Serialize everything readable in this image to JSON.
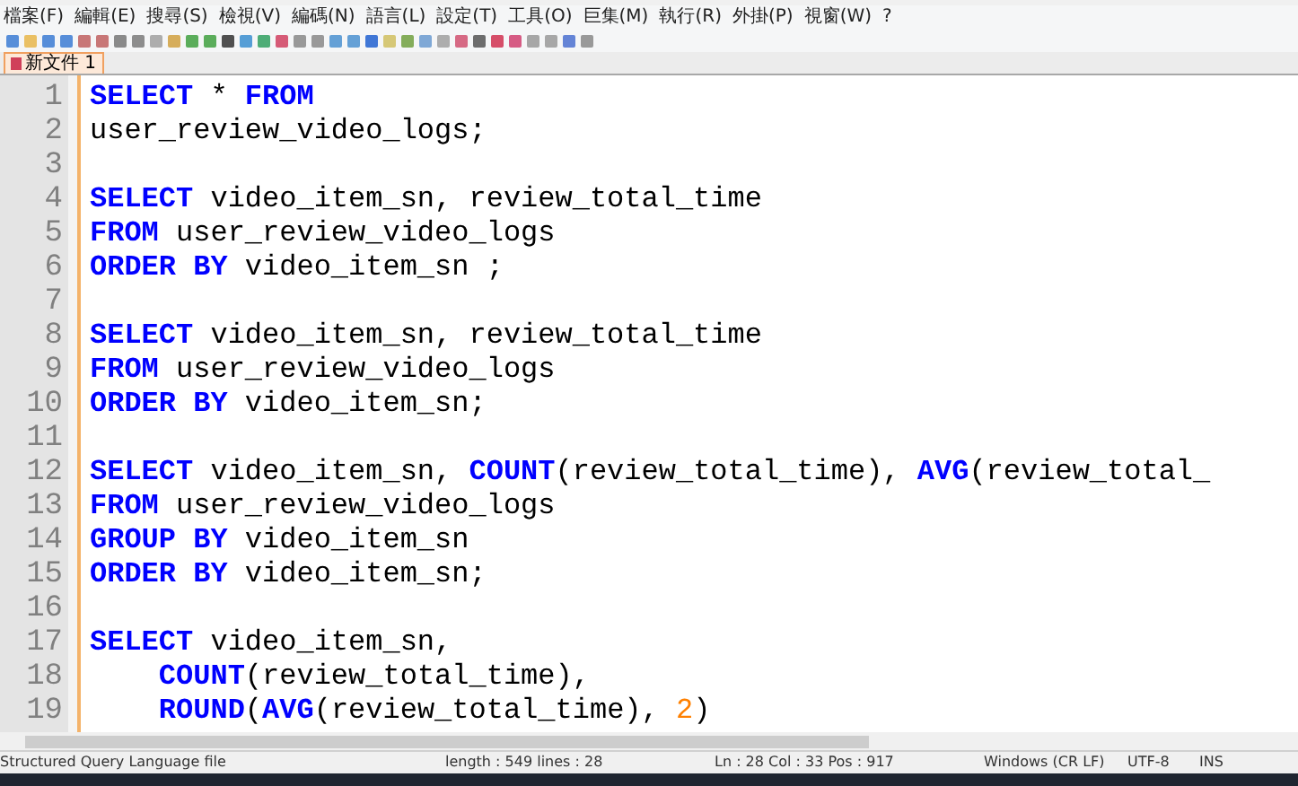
{
  "menu": [
    "檔案(F)",
    "編輯(E)",
    "搜尋(S)",
    "檢視(V)",
    "編碼(N)",
    "語言(L)",
    "設定(T)",
    "工具(O)",
    "巨集(M)",
    "執行(R)",
    "外掛(P)",
    "視窗(W)",
    "?"
  ],
  "tabs": [
    {
      "label": "新文件 1",
      "selected": true
    }
  ],
  "editor": {
    "lines": [
      {
        "number": "1",
        "tokens": [
          {
            "kind": "keyword",
            "text": "SELECT"
          },
          {
            "kind": "text",
            "text": " * "
          },
          {
            "kind": "keyword",
            "text": "FROM"
          }
        ]
      },
      {
        "number": "2",
        "tokens": [
          {
            "kind": "text",
            "text": "user_review_video_logs;"
          }
        ]
      },
      {
        "number": "3"
      },
      {
        "number": "4",
        "tokens": [
          {
            "kind": "keyword",
            "text": "SELECT"
          },
          {
            "kind": "text",
            "text": " video_item_sn, review_total_time"
          }
        ]
      },
      {
        "number": "5",
        "tokens": [
          {
            "kind": "keyword",
            "text": "FROM"
          },
          {
            "kind": "text",
            "text": " user_review_video_logs"
          }
        ]
      },
      {
        "number": "6",
        "tokens": [
          {
            "kind": "keyword",
            "text": "ORDER BY"
          },
          {
            "kind": "text",
            "text": " video_item_sn ;"
          }
        ]
      },
      {
        "number": "7"
      },
      {
        "number": "8",
        "tokens": [
          {
            "kind": "keyword",
            "text": "SELECT"
          },
          {
            "kind": "text",
            "text": " video_item_sn, review_total_time"
          }
        ]
      },
      {
        "number": "9",
        "tokens": [
          {
            "kind": "keyword",
            "text": "FROM"
          },
          {
            "kind": "text",
            "text": " user_review_video_logs"
          }
        ]
      },
      {
        "number": "10",
        "tokens": [
          {
            "kind": "keyword",
            "text": "ORDER BY"
          },
          {
            "kind": "text",
            "text": " video_item_sn;"
          }
        ]
      },
      {
        "number": "11"
      },
      {
        "number": "12",
        "tokens": [
          {
            "kind": "keyword",
            "text": "SELECT"
          },
          {
            "kind": "text",
            "text": " video_item_sn, "
          },
          {
            "kind": "keyword",
            "text": "COUNT"
          },
          {
            "kind": "text",
            "text": "(review_total_time), "
          },
          {
            "kind": "keyword",
            "text": "AVG"
          },
          {
            "kind": "text",
            "text": "(review_total_"
          }
        ]
      },
      {
        "number": "13",
        "tokens": [
          {
            "kind": "keyword",
            "text": "FROM"
          },
          {
            "kind": "text",
            "text": " user_review_video_logs"
          }
        ]
      },
      {
        "number": "14",
        "tokens": [
          {
            "kind": "keyword",
            "text": "GROUP BY"
          },
          {
            "kind": "text",
            "text": " video_item_sn"
          }
        ]
      },
      {
        "number": "15",
        "tokens": [
          {
            "kind": "keyword",
            "text": "ORDER BY"
          },
          {
            "kind": "text",
            "text": " video_item_sn;"
          }
        ]
      },
      {
        "number": "16"
      },
      {
        "number": "17",
        "tokens": [
          {
            "kind": "keyword",
            "text": "SELECT"
          },
          {
            "kind": "text",
            "text": " video_item_sn,"
          }
        ]
      },
      {
        "number": "18",
        "indented": true,
        "tokens": [
          {
            "kind": "keyword",
            "text": "COUNT"
          },
          {
            "kind": "text",
            "text": "(review_total_time),"
          }
        ]
      },
      {
        "number": "19",
        "indented": true,
        "tokens": [
          {
            "kind": "keyword",
            "text": "ROUND"
          },
          {
            "kind": "text",
            "text": "("
          },
          {
            "kind": "keyword",
            "text": "AVG"
          },
          {
            "kind": "text",
            "text": "(review_total_time), "
          },
          {
            "kind": "number",
            "text": "2"
          },
          {
            "kind": "text",
            "text": ")"
          }
        ]
      }
    ]
  },
  "status_bar": {
    "file_type": "Structured Query Language file",
    "length": "length : 549    lines : 28",
    "position": "Ln : 28    Col : 33    Pos : 917",
    "eol": "Windows (CR LF)",
    "encoding": "UTF-8",
    "mode": "INS"
  }
}
